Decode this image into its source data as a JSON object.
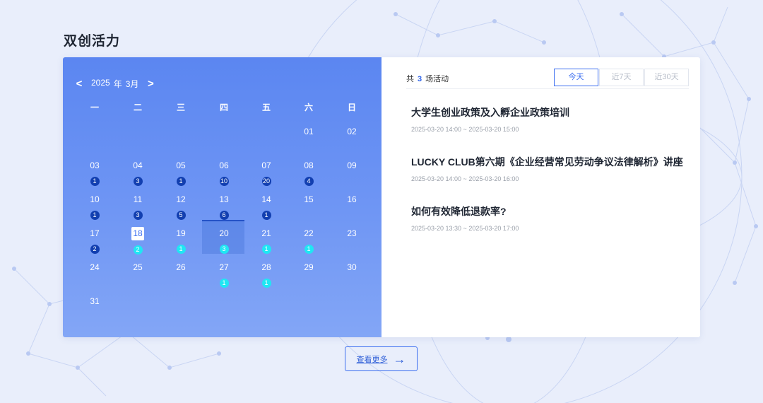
{
  "section": {
    "title": "双创活力"
  },
  "calendar": {
    "prev_label": "<",
    "next_label": ">",
    "year": "2025",
    "year_unit": "年",
    "month": "3月",
    "weekdays": [
      "一",
      "二",
      "三",
      "四",
      "五",
      "六",
      "日"
    ],
    "days": [
      {
        "n": "01",
        "col": 5,
        "row": 0
      },
      {
        "n": "02",
        "col": 6,
        "row": 0
      },
      {
        "n": "03",
        "col": 0,
        "row": 1,
        "count": "1",
        "style": "dark"
      },
      {
        "n": "04",
        "col": 1,
        "row": 1,
        "count": "3",
        "style": "dark"
      },
      {
        "n": "05",
        "col": 2,
        "row": 1,
        "count": "1",
        "style": "dark"
      },
      {
        "n": "06",
        "col": 3,
        "row": 1,
        "count": "10",
        "style": "dark"
      },
      {
        "n": "07",
        "col": 4,
        "row": 1,
        "count": "20",
        "style": "dark"
      },
      {
        "n": "08",
        "col": 5,
        "row": 1,
        "count": "4",
        "style": "dark"
      },
      {
        "n": "09",
        "col": 6,
        "row": 1
      },
      {
        "n": "10",
        "col": 0,
        "row": 2,
        "count": "1",
        "style": "dark"
      },
      {
        "n": "11",
        "col": 1,
        "row": 2,
        "count": "3",
        "style": "dark"
      },
      {
        "n": "12",
        "col": 2,
        "row": 2,
        "count": "5",
        "style": "dark"
      },
      {
        "n": "13",
        "col": 3,
        "row": 2,
        "count": "6",
        "style": "dark"
      },
      {
        "n": "14",
        "col": 4,
        "row": 2,
        "count": "1",
        "style": "dark"
      },
      {
        "n": "15",
        "col": 5,
        "row": 2
      },
      {
        "n": "16",
        "col": 6,
        "row": 2
      },
      {
        "n": "17",
        "col": 0,
        "row": 3,
        "count": "2",
        "style": "dark"
      },
      {
        "n": "18",
        "col": 1,
        "row": 3,
        "count": "2",
        "style": "cyan",
        "today": true
      },
      {
        "n": "19",
        "col": 2,
        "row": 3,
        "count": "1",
        "style": "cyan"
      },
      {
        "n": "20",
        "col": 3,
        "row": 3,
        "count": "3",
        "style": "cyan",
        "selected": true
      },
      {
        "n": "21",
        "col": 4,
        "row": 3,
        "count": "1",
        "style": "cyan"
      },
      {
        "n": "22",
        "col": 5,
        "row": 3,
        "count": "1",
        "style": "cyan"
      },
      {
        "n": "23",
        "col": 6,
        "row": 3
      },
      {
        "n": "24",
        "col": 0,
        "row": 4
      },
      {
        "n": "25",
        "col": 1,
        "row": 4
      },
      {
        "n": "26",
        "col": 2,
        "row": 4
      },
      {
        "n": "27",
        "col": 3,
        "row": 4,
        "count": "1",
        "style": "cyan"
      },
      {
        "n": "28",
        "col": 4,
        "row": 4,
        "count": "1",
        "style": "cyan"
      },
      {
        "n": "29",
        "col": 5,
        "row": 4
      },
      {
        "n": "30",
        "col": 6,
        "row": 4
      },
      {
        "n": "31",
        "col": 0,
        "row": 5
      }
    ]
  },
  "events_panel": {
    "count_prefix": "共",
    "count": "3",
    "count_suffix": "场活动",
    "tabs": [
      {
        "label": "今天",
        "active": true
      },
      {
        "label": "近7天",
        "active": false
      },
      {
        "label": "近30天",
        "active": false
      }
    ],
    "events": [
      {
        "title": "大学生创业政策及入孵企业政策培训",
        "time": "2025-03-20 14:00 ~ 2025-03-20 15:00"
      },
      {
        "title": "LUCKY CLUB第六期《企业经营常见劳动争议法律解析》讲座",
        "time": "2025-03-20 14:00 ~ 2025-03-20 16:00"
      },
      {
        "title": "如何有效降低退款率?",
        "time": "2025-03-20 13:30 ~ 2025-03-20 17:00"
      }
    ]
  },
  "more_button": {
    "label": "查看更多",
    "icon": "arrow-right-icon"
  },
  "colors": {
    "accent": "#3b6ef0",
    "calendar_bg": "#5b86f1",
    "badge_dark": "#123fb0",
    "badge_cyan": "#1fe7f3",
    "page_bg": "#e9eefb"
  }
}
